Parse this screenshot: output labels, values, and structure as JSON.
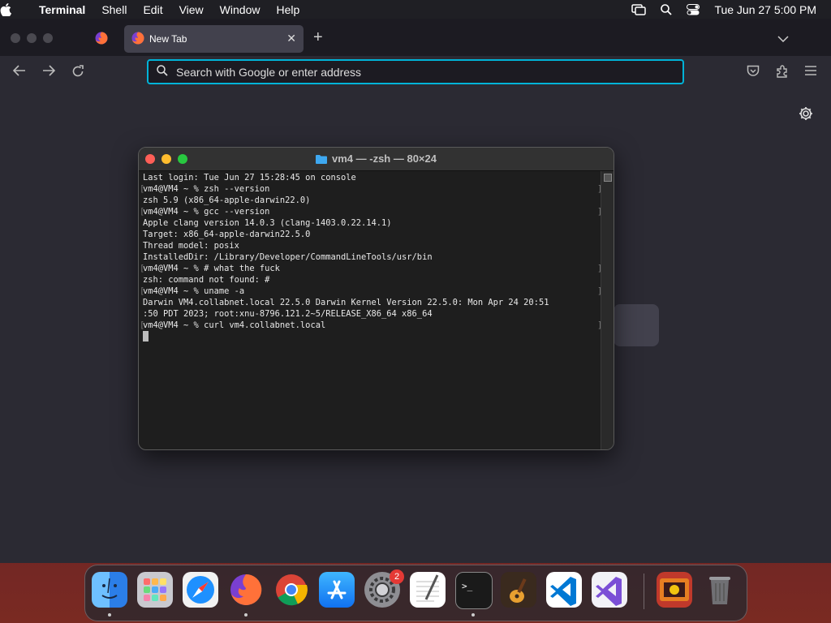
{
  "menubar": {
    "app_name": "Terminal",
    "items": [
      "Shell",
      "Edit",
      "View",
      "Window",
      "Help"
    ],
    "clock": "Tue Jun 27  5:00 PM"
  },
  "browser": {
    "tab_title": "New Tab",
    "url_placeholder": "Search with Google or enter address"
  },
  "terminal": {
    "title": "vm4 — -zsh — 80×24",
    "lines": [
      {
        "text": "Last login: Tue Jun 27 15:28:45 on console",
        "mark": false
      },
      {
        "text": "vm4@VM4 ~ % zsh --version",
        "mark": true
      },
      {
        "text": "zsh 5.9 (x86_64-apple-darwin22.0)",
        "mark": false
      },
      {
        "text": "vm4@VM4 ~ % gcc --version",
        "mark": true
      },
      {
        "text": "Apple clang version 14.0.3 (clang-1403.0.22.14.1)",
        "mark": false
      },
      {
        "text": "Target: x86_64-apple-darwin22.5.0",
        "mark": false
      },
      {
        "text": "Thread model: posix",
        "mark": false
      },
      {
        "text": "InstalledDir: /Library/Developer/CommandLineTools/usr/bin",
        "mark": false
      },
      {
        "text": "vm4@VM4 ~ % # what the fuck",
        "mark": true
      },
      {
        "text": "zsh: command not found: #",
        "mark": false
      },
      {
        "text": "vm4@VM4 ~ % uname -a",
        "mark": true
      },
      {
        "text": "Darwin VM4.collabnet.local 22.5.0 Darwin Kernel Version 22.5.0: Mon Apr 24 20:51",
        "mark": false
      },
      {
        "text": ":50 PDT 2023; root:xnu-8796.121.2~5/RELEASE_X86_64 x86_64",
        "mark": false
      },
      {
        "text": "vm4@VM4 ~ % curl vm4.collabnet.local",
        "mark": true
      }
    ]
  },
  "dock": {
    "badge_count": "2",
    "apps": [
      "finder",
      "launchpad",
      "safari",
      "firefox",
      "chrome",
      "app-store",
      "system-settings",
      "textedit",
      "terminal",
      "garageband",
      "vscode",
      "visual-studio",
      "photo-booth",
      "trash"
    ]
  },
  "colors": {
    "accent": "#00b3d8",
    "terminal_bg": "#1e1e1e",
    "browser_bg": "#2b2a33"
  }
}
